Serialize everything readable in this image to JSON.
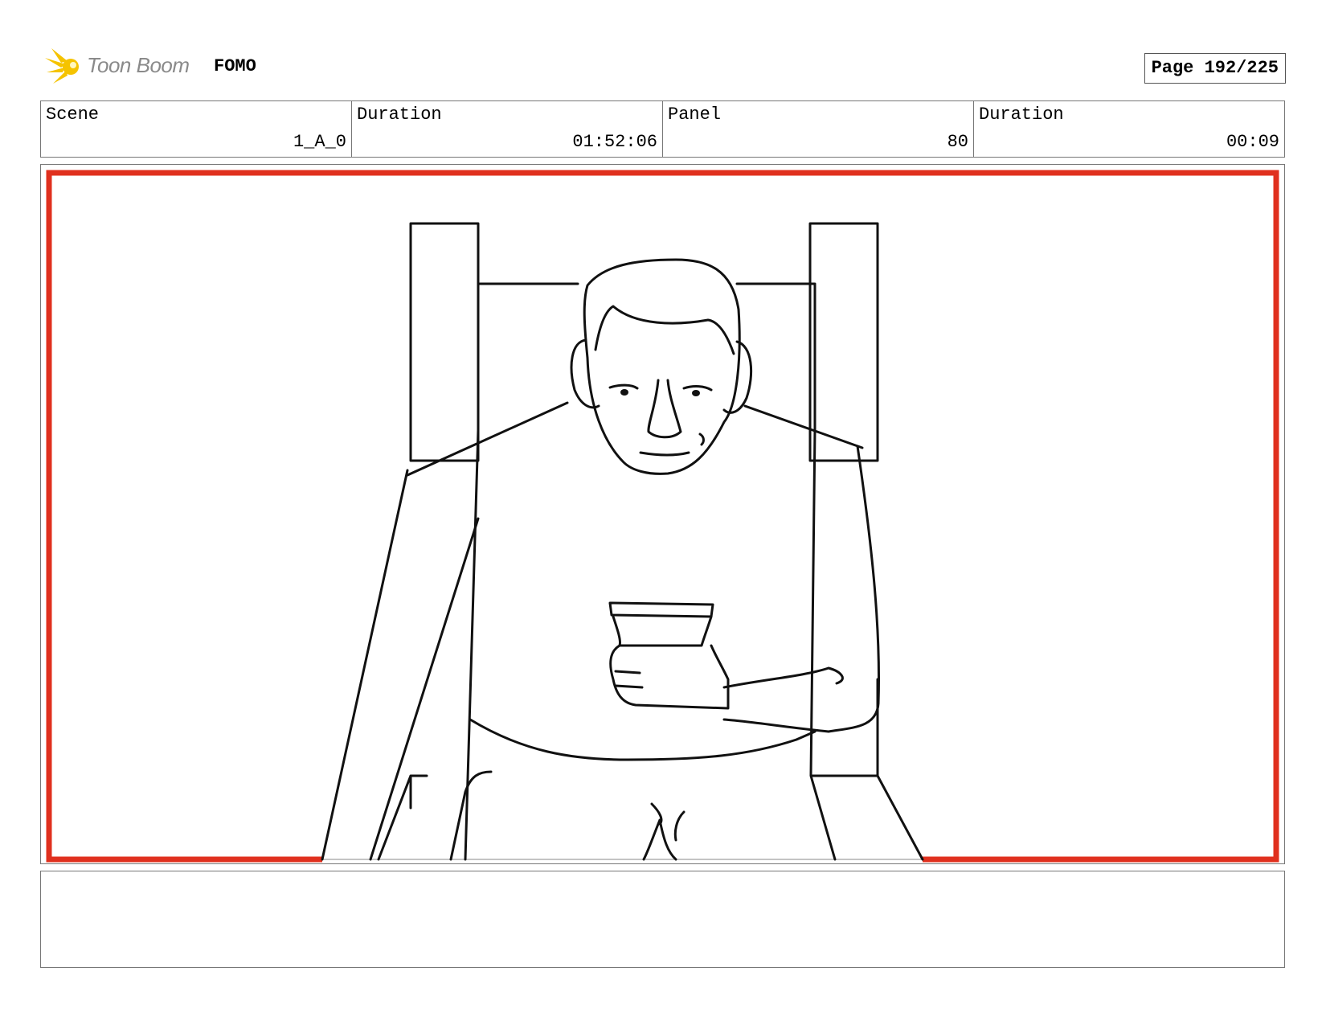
{
  "header": {
    "brand_name": "Toon Boom",
    "project_title": "FOMO",
    "page_label": "Page 192/225"
  },
  "info": {
    "scene_label": "Scene",
    "scene_value": "1_A_0",
    "duration_label": "Duration",
    "duration_value": "01:52:06",
    "panel_label": "Panel",
    "panel_value": "80",
    "panel_duration_label": "Duration",
    "panel_duration_value": "00:09"
  },
  "colors": {
    "safe_frame": "#e0301e",
    "logo_yellow": "#f5c300"
  },
  "notes": {
    "text": ""
  }
}
